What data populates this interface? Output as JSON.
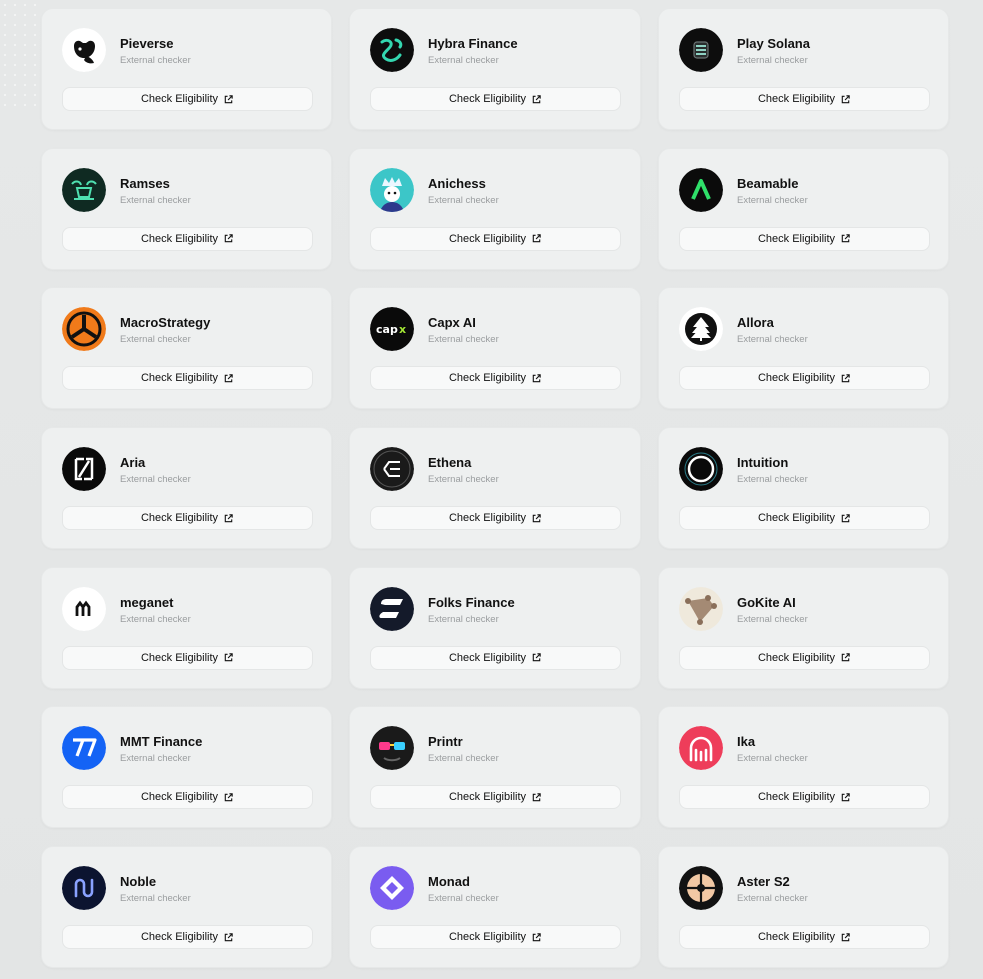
{
  "subtitle": "External checker",
  "button_label": "Check Eligibility",
  "items": [
    {
      "name": "Pieverse",
      "logo": "pieverse-bear-logo",
      "logo_bg": "#ffffff"
    },
    {
      "name": "Hybra Finance",
      "logo": "hybra-swirl-logo",
      "logo_bg": "#0d0d0d"
    },
    {
      "name": "Play Solana",
      "logo": "play-solana-logo",
      "logo_bg": "#0d0d0d"
    },
    {
      "name": "Ramses",
      "logo": "ramses-ram-logo",
      "logo_bg": "#0f2a22"
    },
    {
      "name": "Anichess",
      "logo": "anichess-king-logo",
      "logo_bg": "#3cc6c8"
    },
    {
      "name": "Beamable",
      "logo": "beamable-chevron-logo",
      "logo_bg": "#0b0b0b"
    },
    {
      "name": "MacroStrategy",
      "logo": "macrostrategy-logo",
      "logo_bg": "#f07a1a"
    },
    {
      "name": "Capx AI",
      "logo": "capx-wordmark-logo",
      "logo_bg": "#0a0a0a"
    },
    {
      "name": "Allora",
      "logo": "allora-tree-logo",
      "logo_bg": "#ffffff"
    },
    {
      "name": "Aria",
      "logo": "aria-bracket-logo",
      "logo_bg": "#0a0a0a"
    },
    {
      "name": "Ethena",
      "logo": "ethena-logo",
      "logo_bg": "#1a1a1a"
    },
    {
      "name": "Intuition",
      "logo": "intuition-ring-logo",
      "logo_bg": "#0a0a0a"
    },
    {
      "name": "meganet",
      "logo": "meganet-logo",
      "logo_bg": "#ffffff"
    },
    {
      "name": "Folks Finance",
      "logo": "folks-finance-logo",
      "logo_bg": "#141a2a"
    },
    {
      "name": "GoKite AI",
      "logo": "gokite-kite-logo",
      "logo_bg": "#efe9dc"
    },
    {
      "name": "MMT Finance",
      "logo": "mmt-finance-logo",
      "logo_bg": "#1463f5"
    },
    {
      "name": "Printr",
      "logo": "printr-glasses-logo",
      "logo_bg": "#1a1a1a"
    },
    {
      "name": "Ika",
      "logo": "ika-octopus-logo",
      "logo_bg": "#ee3d5a"
    },
    {
      "name": "Noble",
      "logo": "noble-logo",
      "logo_bg": "#0c1430"
    },
    {
      "name": "Monad",
      "logo": "monad-logo",
      "logo_bg": "#7a5cf0"
    },
    {
      "name": "Aster S2",
      "logo": "aster-star-logo",
      "logo_bg": "#121212"
    }
  ]
}
